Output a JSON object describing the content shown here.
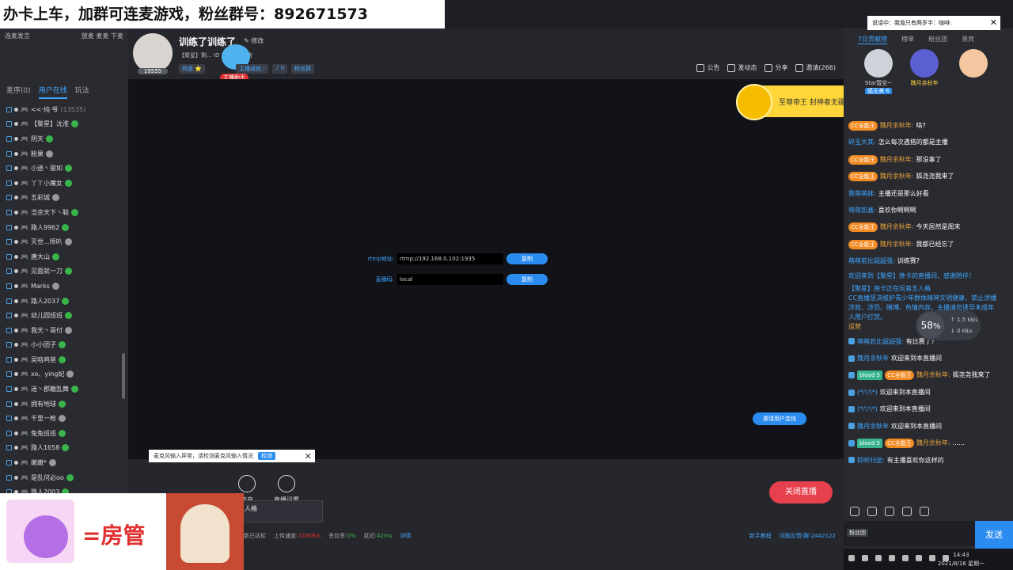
{
  "banner": {
    "text": "办卡上车，加群可连麦游戏，粉丝群号：892671573"
  },
  "left": {
    "top_left": "连麦发言",
    "top_right": "放麦 麦麦 下麦",
    "tabs": [
      "麦序(0)",
      "用户在线",
      "玩法"
    ],
    "active_tab": 1,
    "users": [
      {
        "name": "<<·纯·爷",
        "extra": "(13535)"
      },
      {
        "name": "【聚星】沈淮"
      },
      {
        "name": "阴天"
      },
      {
        "name": "粉果"
      },
      {
        "name": "小迪丶丽如"
      },
      {
        "name": "丫丫小魔女"
      },
      {
        "name": "五彩城"
      },
      {
        "name": "浩余天下丶聪"
      },
      {
        "name": "路人9962"
      },
      {
        "name": "灭世...师叭"
      },
      {
        "name": "唐大山"
      },
      {
        "name": "见面就一刀"
      },
      {
        "name": "Marks"
      },
      {
        "name": "路人2037"
      },
      {
        "name": "幼儿园班班"
      },
      {
        "name": "我天丶哥付"
      },
      {
        "name": "小小团子"
      },
      {
        "name": "吴晗鸡爸"
      },
      {
        "name": "xo、ying妃"
      },
      {
        "name": "迷丶郡離乱舞"
      },
      {
        "name": "拥有地球"
      },
      {
        "name": "千里一枪"
      },
      {
        "name": "兔兔班班"
      },
      {
        "name": "路人1658"
      },
      {
        "name": "嫩嫩*"
      },
      {
        "name": "是乱何必oo"
      },
      {
        "name": "路人2003"
      }
    ]
  },
  "header": {
    "title": "训练了训练了",
    "edit": "修改",
    "avatar_num": "19555",
    "sub": "【聚星】剩...  ID 36  第五人格",
    "tags": [
      "热度 ⭐",
      "主播成就 ›",
      "♪ 0",
      "粉丝群"
    ],
    "assistant": "主播助手",
    "actions": [
      "公告",
      "发动态",
      "分享",
      "邀请(266)"
    ]
  },
  "gold_banner": "至尊帝王 封神者无疆",
  "stream": {
    "rtmp_label": "rtmp地址:",
    "rtmp_value": "rtmp://192.168.0.102:1935",
    "key_label": "直播码:",
    "key_value": "local",
    "copy": "复制",
    "connect": "邀请用户连线"
  },
  "mic_warning": {
    "text": "麦克风输入异常，请检测麦克风输入情况",
    "detect": "检测"
  },
  "controls": [
    {
      "label": "声音"
    },
    {
      "label": "直播设置"
    }
  ],
  "close_live": "关闭直播",
  "game_thumb": "第五人格",
  "status": {
    "left0": "数已达标",
    "upload_label": "上传速度:",
    "upload": "720KB/s",
    "loss_label": "丢包率:",
    "loss": "0%",
    "delay_label": "延迟:",
    "delay": "42ms",
    "detail": "详情",
    "right": [
      "新手教程",
      "问题反馈(群:2442122"
    ]
  },
  "moderator": {
    "text": "=房管"
  },
  "right": {
    "notice": "说话中：我竟只有两岁半：咖啡:",
    "tabs": [
      "7日贡献榜",
      "榜单",
      "粉丝团",
      "贵宾"
    ],
    "ranks": [
      {
        "name": "Star暂空~",
        "badge": "狐无美 6"
      },
      {
        "name": "魏月余秋年"
      },
      {
        "name": ""
      }
    ],
    "chat": [
      {
        "cc": "CC全能王",
        "user": "魏月余秋年:",
        "text": "啥?"
      },
      {
        "user": "碎玉大其:",
        "text": "怎么每次遇搭的都是主播"
      },
      {
        "cc": "CC全能王",
        "user": "魏月余秋年:",
        "text": "那没事了"
      },
      {
        "cc": "CC全能王",
        "user": "魏月余秋年:",
        "text": "狐尧尧我来了"
      },
      {
        "user": "我萌萌妹:",
        "text": "主播还是那么好看"
      },
      {
        "user": "萌萌凯鑫:",
        "text": "喜欢你啊啊啊"
      },
      {
        "cc": "CC全能王",
        "user": "魏月余秋年:",
        "text": "今天居然是周末"
      },
      {
        "cc": "CC全能王",
        "user": "魏月余秋年:",
        "text": "我都已经忘了"
      },
      {
        "user": "萌萌若比超超强:",
        "text": "训练赛?"
      }
    ],
    "system1": "欢迎来到【聚星】挽卡的直播间，感谢陪伴！",
    "system2a": "【聚星】挽卡正在玩第五人格",
    "system2b": "CC直播坚决维护青少年群体精神文明健康，禁止涉播涉政、涉恐、赌博、色情内容，主播请勿诱导未成年人用户打赏。",
    "system2c": "运营",
    "chat2": [
      {
        "user": "萌萌若比超超强:",
        "text": "有比赛了?"
      },
      {
        "user": "魏月余秋年",
        "text": "欢迎来到本直播间"
      },
      {
        "lv": "blood 5",
        "cc": "CC全能王",
        "user": "魏月余秋年:",
        "text": "狐尧尧我来了"
      },
      {
        "user": "(*/▽\\*)",
        "text": "欢迎来到本直播间"
      },
      {
        "user": "(*/▽\\*)",
        "text": "欢迎来到本直播间"
      },
      {
        "user": "魏月余秋年",
        "text": "欢迎来到本直播间"
      },
      {
        "lv": "blood 5",
        "cc": "CC全能王",
        "user": "魏月余秋年:",
        "text": "......"
      },
      {
        "user": "聆听归途:",
        "text": "有主播喜欢你这样的"
      }
    ],
    "net_pct": "58",
    "net_up": "1.5",
    "net_down": "0",
    "input_ph": "粉丝团",
    "send": "发送",
    "time": "14:43",
    "date": "2021/8/16 星期一"
  }
}
